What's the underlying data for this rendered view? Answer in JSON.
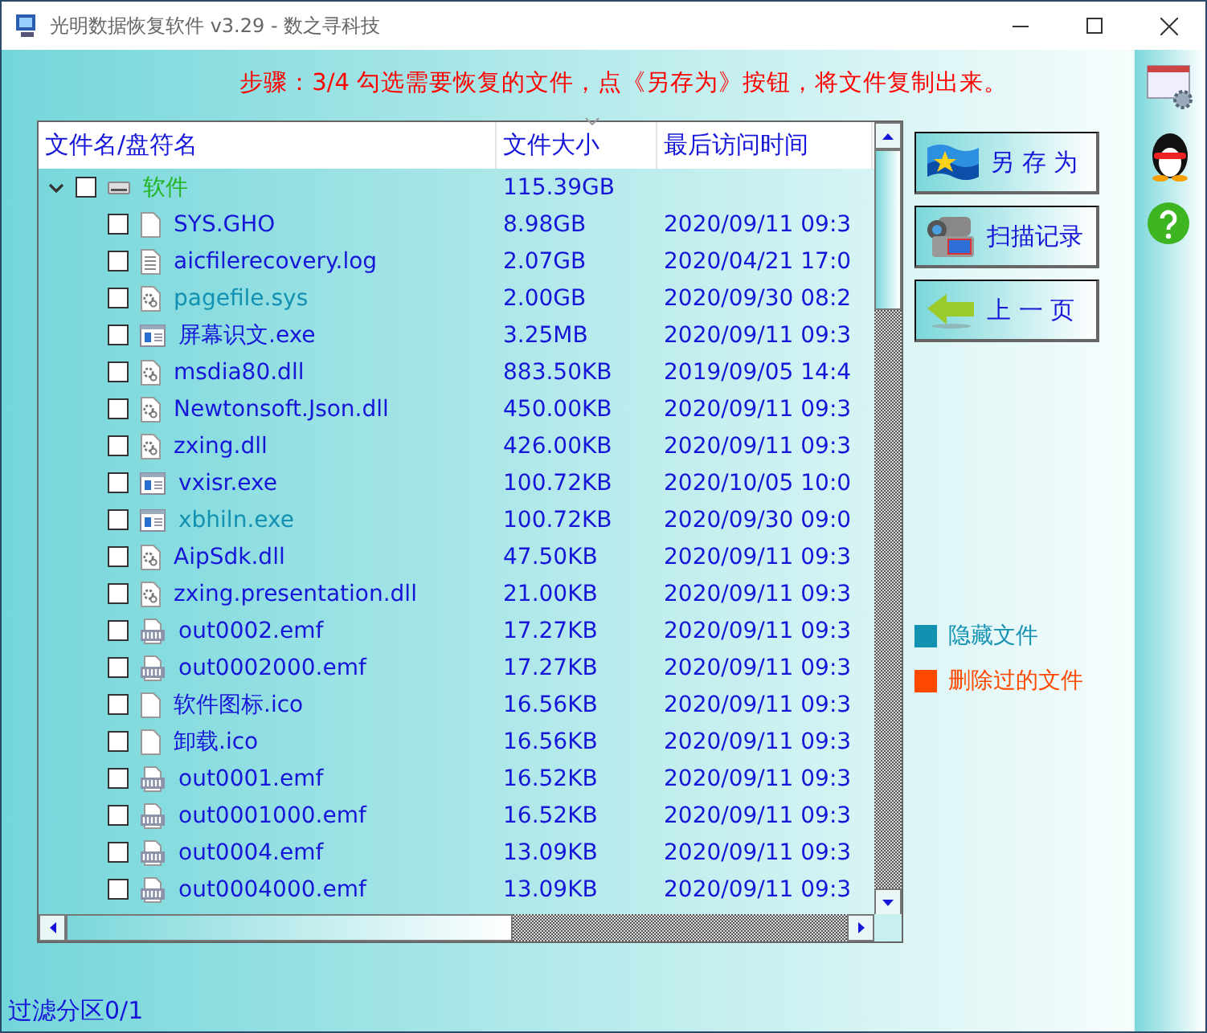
{
  "window": {
    "title": "光明数据恢复软件 v3.29 - 数之寻科技"
  },
  "instruction": "步骤：3/4 勾选需要恢复的文件，点《另存为》按钮，将文件复制出来。",
  "table": {
    "columns": [
      "文件名/盘符名",
      "文件大小",
      "最后访问时间"
    ],
    "tree": [
      {
        "kind": "drive",
        "name": "软件",
        "size": "115.39GB",
        "checked": false,
        "expanded": true,
        "children": [
          {
            "kind": "blank",
            "name": "SYS.GHO",
            "size": "8.98GB",
            "date": "2020/09/11 09:3",
            "checked": false,
            "hidden": false
          },
          {
            "kind": "text",
            "name": "aicfilerecovery.log",
            "size": "2.07GB",
            "date": "2020/04/21 17:0",
            "checked": false,
            "hidden": false
          },
          {
            "kind": "gear",
            "name": "pagefile.sys",
            "size": "2.00GB",
            "date": "2020/09/30 08:2",
            "checked": false,
            "hidden": true
          },
          {
            "kind": "exe",
            "name": "屏幕识文.exe",
            "size": "3.25MB",
            "date": "2020/09/11 09:3",
            "checked": false,
            "hidden": false
          },
          {
            "kind": "gear",
            "name": "msdia80.dll",
            "size": "883.50KB",
            "date": "2019/09/05 14:4",
            "checked": false,
            "hidden": false
          },
          {
            "kind": "gear",
            "name": "Newtonsoft.Json.dll",
            "size": "450.00KB",
            "date": "2020/09/11 09:3",
            "checked": false,
            "hidden": false
          },
          {
            "kind": "gear",
            "name": "zxing.dll",
            "size": "426.00KB",
            "date": "2020/09/11 09:3",
            "checked": false,
            "hidden": false
          },
          {
            "kind": "exe",
            "name": "vxisr.exe",
            "size": "100.72KB",
            "date": "2020/10/05 10:0",
            "checked": false,
            "hidden": false
          },
          {
            "kind": "exe",
            "name": "xbhiln.exe",
            "size": "100.72KB",
            "date": "2020/09/30 09:0",
            "checked": false,
            "hidden": true
          },
          {
            "kind": "gear",
            "name": "AipSdk.dll",
            "size": "47.50KB",
            "date": "2020/09/11 09:3",
            "checked": false,
            "hidden": false
          },
          {
            "kind": "gear",
            "name": "zxing.presentation.dll",
            "size": "21.00KB",
            "date": "2020/09/11 09:3",
            "checked": false,
            "hidden": false
          },
          {
            "kind": "emf",
            "name": "out0002.emf",
            "size": "17.27KB",
            "date": "2020/09/11 09:3",
            "checked": false,
            "hidden": false
          },
          {
            "kind": "emf",
            "name": "out0002000.emf",
            "size": "17.27KB",
            "date": "2020/09/11 09:3",
            "checked": false,
            "hidden": false
          },
          {
            "kind": "blank",
            "name": "软件图标.ico",
            "size": "16.56KB",
            "date": "2020/09/11 09:3",
            "checked": false,
            "hidden": false
          },
          {
            "kind": "blank",
            "name": "卸载.ico",
            "size": "16.56KB",
            "date": "2020/09/11 09:3",
            "checked": false,
            "hidden": false
          },
          {
            "kind": "emf",
            "name": "out0001.emf",
            "size": "16.52KB",
            "date": "2020/09/11 09:3",
            "checked": false,
            "hidden": false
          },
          {
            "kind": "emf",
            "name": "out0001000.emf",
            "size": "16.52KB",
            "date": "2020/09/11 09:3",
            "checked": false,
            "hidden": false
          },
          {
            "kind": "emf",
            "name": "out0004.emf",
            "size": "13.09KB",
            "date": "2020/09/11 09:3",
            "checked": false,
            "hidden": false
          },
          {
            "kind": "emf",
            "name": "out0004000.emf",
            "size": "13.09KB",
            "date": "2020/09/11 09:3",
            "checked": false,
            "hidden": false
          }
        ]
      }
    ]
  },
  "buttons": [
    {
      "kind": "save",
      "label": "另 存 为"
    },
    {
      "kind": "scan",
      "label": "扫描记录"
    },
    {
      "kind": "back",
      "label": "上 一 页"
    }
  ],
  "legend": [
    {
      "label": "隐藏文件",
      "color": "#1391b3"
    },
    {
      "label": "删除过的文件",
      "color": "#ff4800"
    }
  ],
  "status_bar": "过滤分区0/1"
}
